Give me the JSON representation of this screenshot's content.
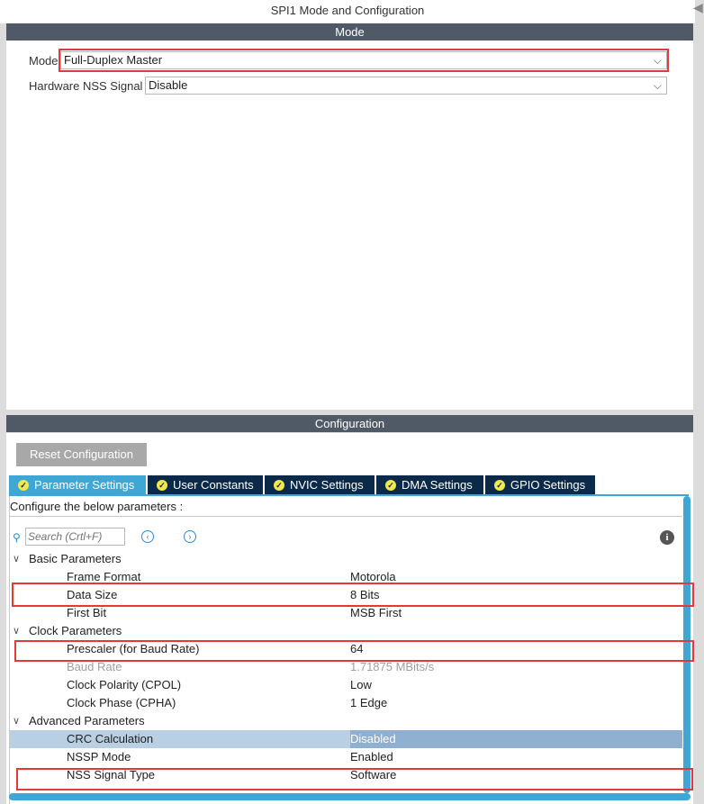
{
  "window": {
    "title": "SPI1 Mode and Configuration"
  },
  "mode_section": {
    "header": "Mode",
    "mode_label": "Mode",
    "mode_value": "Full-Duplex Master",
    "nss_label": "Hardware NSS Signal",
    "nss_value": "Disable"
  },
  "config_section": {
    "header": "Configuration",
    "reset_button": "Reset Configuration",
    "tabs": [
      {
        "label": "Parameter Settings",
        "active": true
      },
      {
        "label": "User Constants",
        "active": false
      },
      {
        "label": "NVIC Settings",
        "active": false
      },
      {
        "label": "DMA Settings",
        "active": false
      },
      {
        "label": "GPIO Settings",
        "active": false
      }
    ],
    "hint": "Configure the below parameters :",
    "search_placeholder": "Search (Crtl+F)",
    "groups": [
      {
        "name": "Basic Parameters",
        "params": [
          {
            "name": "Frame Format",
            "value": "Motorola"
          },
          {
            "name": "Data Size",
            "value": "8 Bits"
          },
          {
            "name": "First Bit",
            "value": "MSB First"
          }
        ]
      },
      {
        "name": "Clock Parameters",
        "params": [
          {
            "name": "Prescaler (for Baud Rate)",
            "value": "64"
          },
          {
            "name": "Baud Rate",
            "value": "1.71875 MBits/s"
          },
          {
            "name": "Clock Polarity (CPOL)",
            "value": "Low"
          },
          {
            "name": "Clock Phase (CPHA)",
            "value": "1 Edge"
          }
        ]
      },
      {
        "name": "Advanced Parameters",
        "params": [
          {
            "name": "CRC Calculation",
            "value": "Disabled"
          },
          {
            "name": "NSSP Mode",
            "value": "Enabled"
          },
          {
            "name": "NSS Signal Type",
            "value": "Software"
          }
        ]
      }
    ]
  },
  "colors": {
    "section_bar": "#505a66",
    "active_tab": "#3fa7d6",
    "inactive_tab": "#0b2a4a",
    "highlight_box": "#e23a3a",
    "selected_row": "#b9cfe4"
  }
}
